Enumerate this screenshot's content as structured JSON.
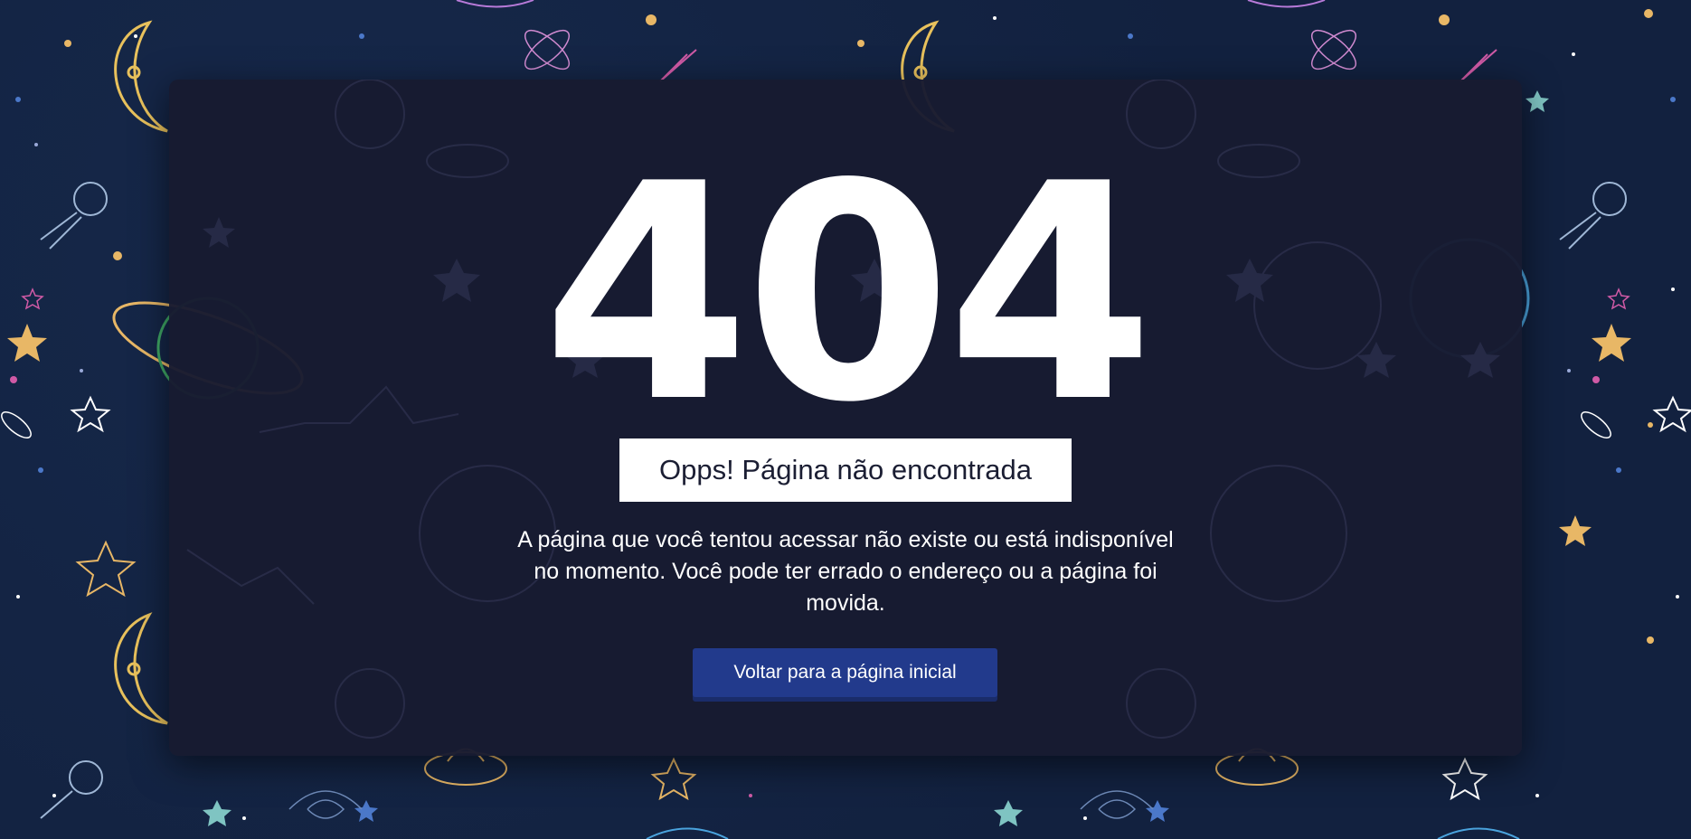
{
  "page": {
    "error_code": "404",
    "title": "Opps! Página não encontrada",
    "description": "A página que você tentou acessar não existe ou está indisponível no momento. Você pode ter errado o endereço ou a página foi movida.",
    "home_button_label": "Voltar para a página inicial"
  },
  "colors": {
    "background": "#12213f",
    "card": "#181b31",
    "button": "#223a8c",
    "star_gold": "#e8b766",
    "star_teal": "#7fc4c2",
    "comet_pink": "#d05aa6"
  },
  "icons": [
    "moon-icon",
    "star-icon",
    "planet-icon",
    "satellite-icon",
    "ufo-icon",
    "comet-icon",
    "atom-icon",
    "globe-icon",
    "galaxy-icon"
  ]
}
